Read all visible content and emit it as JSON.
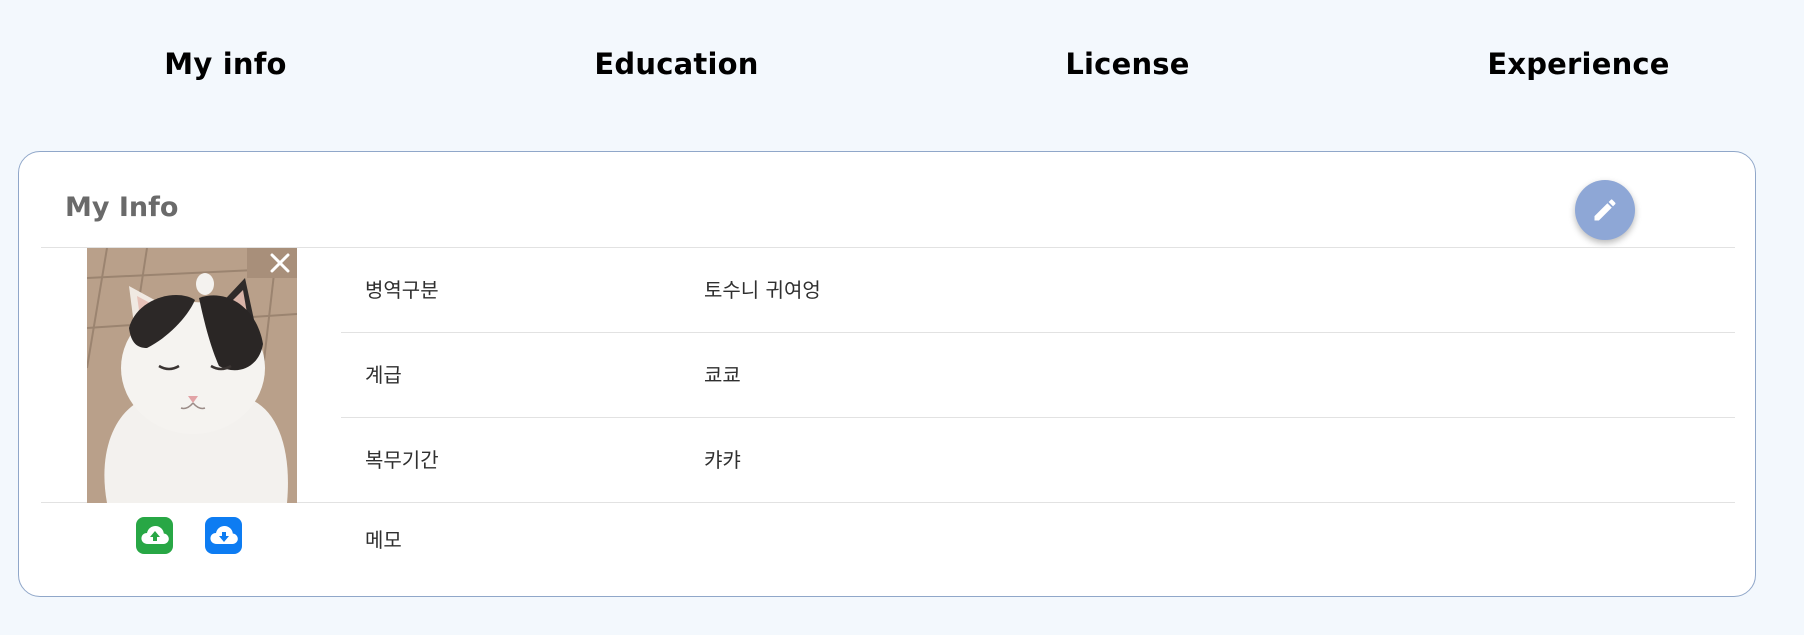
{
  "tabs": [
    {
      "label": "My info"
    },
    {
      "label": "Education"
    },
    {
      "label": "License"
    },
    {
      "label": "Experience"
    }
  ],
  "card": {
    "title": "My Info",
    "edit_icon": "pencil-icon",
    "photo": {
      "alt": "cat photo",
      "close_icon": "close-icon"
    },
    "rows": [
      {
        "label": "병역구분",
        "value": "토수니 귀여엉"
      },
      {
        "label": "계급",
        "value": "쿄쿄"
      },
      {
        "label": "복무기간",
        "value": "캬캬"
      }
    ],
    "memo": {
      "label": "메모",
      "value": ""
    },
    "upload_icon": "cloud-upload-icon",
    "download_icon": "cloud-download-icon"
  },
  "colors": {
    "background": "#f3f8fd",
    "card_border": "#90a7c9",
    "fab": "#8ea7d6",
    "upload": "#28a745",
    "download": "#0d7cf2"
  }
}
